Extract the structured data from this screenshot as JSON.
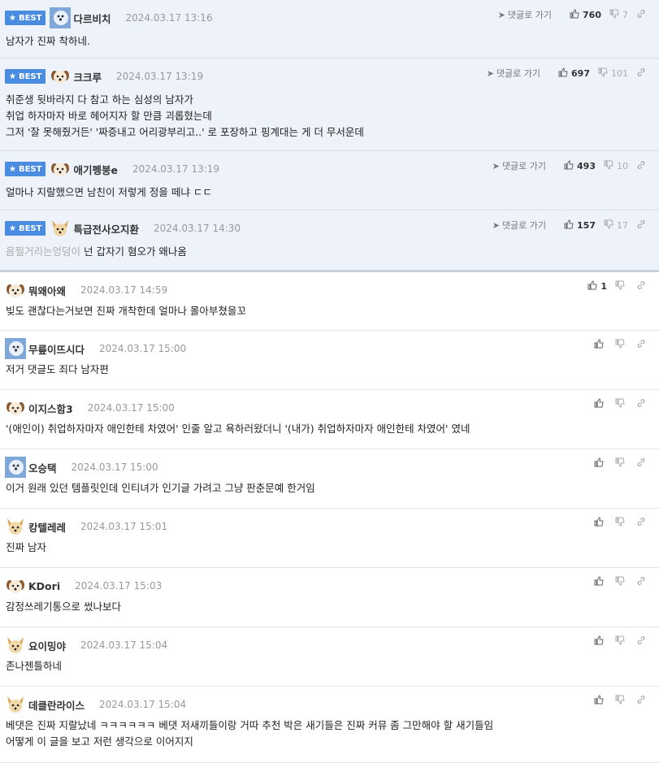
{
  "best_badge": "BEST",
  "reply_label": "댓글로 가기",
  "comments": [
    {
      "nick": "다르비치",
      "date": "2024.03.17 13:16",
      "up": "760",
      "down": "7",
      "lines": [
        "남자가 진짜 착하네."
      ],
      "avatar": "blue"
    },
    {
      "nick": "크크루",
      "date": "2024.03.17 13:19",
      "up": "697",
      "down": "101",
      "lines": [
        "취준생 뒷바라지 다 참고 하는 심성의 남자가",
        "취업 하자마자 바로 헤어지자 할 만큼 괴롭혔는데",
        "그저 '잘 못해줬거든' '짜증내고 어리광부리고..' 로 포장하고 핑계대는 게 더 무서운데"
      ],
      "avatar": "puppy"
    },
    {
      "nick": "애기펭붕e",
      "date": "2024.03.17 13:19",
      "up": "493",
      "down": "10",
      "lines": [
        "얼마나 지랄했으면 남친이 저렇게 정을 떼냐 ㄷㄷ"
      ],
      "avatar": "puppy"
    },
    {
      "nick": "특급전사오지환",
      "date": "2024.03.17 14:30",
      "up": "157",
      "down": "17",
      "mention": "음찔거리는엉덩이",
      "lines": [
        "넌 갑자기 혐오가 왜나옴"
      ],
      "avatar": "fox"
    },
    {
      "nick": "뭐왜아왜",
      "date": "2024.03.17 14:59",
      "up": "1",
      "down": "",
      "lines": [
        "빚도 괜찮다는거보면 진짜 개착한데 얼마나 몰아부쳤을꼬"
      ],
      "avatar": "puppy"
    },
    {
      "nick": "무릎이뜨시다",
      "date": "2024.03.17 15:00",
      "up": "",
      "down": "",
      "lines": [
        "저거 댓글도 죄다 남자편"
      ],
      "avatar": "blue"
    },
    {
      "nick": "이지스함3",
      "date": "2024.03.17 15:00",
      "up": "",
      "down": "",
      "lines": [
        "'(애인이) 취업하자마자 애인한테 차였어' 인줄 알고 욕하러왔더니 '(내가) 취업하자마자 애인한테 차였어' 였네"
      ],
      "avatar": "puppy"
    },
    {
      "nick": "오승택",
      "date": "2024.03.17 15:00",
      "up": "",
      "down": "",
      "lines": [
        "이거 원래 있던 템플릿인데 인티녀가 인기글 가려고 그냥 판춘문예 한거임"
      ],
      "avatar": "blue"
    },
    {
      "nick": "캉텔레레",
      "date": "2024.03.17 15:01",
      "up": "",
      "down": "",
      "lines": [
        "진짜 남자"
      ],
      "avatar": "fox"
    },
    {
      "nick": "KDori",
      "date": "2024.03.17 15:03",
      "up": "",
      "down": "",
      "lines": [
        "감정쓰레기통으로 썼나보다"
      ],
      "avatar": "puppy"
    },
    {
      "nick": "요이밍야",
      "date": "2024.03.17 15:04",
      "up": "",
      "down": "",
      "lines": [
        "존나젠틀하네"
      ],
      "avatar": "fox"
    },
    {
      "nick": "데클란라이스",
      "date": "2024.03.17 15:04",
      "up": "",
      "down": "",
      "lines": [
        "베댓은 진짜 지랄났네 ㅋㅋㅋㅋㅋㅋ 베댓 저새끼들이랑 거따 추천 박은 새기들은 진짜 커뮤 좀 그만해야 할 새기들임",
        "어떻게 이 글을 보고 저런 생각으로 이어지지"
      ],
      "avatar": "fox"
    }
  ]
}
